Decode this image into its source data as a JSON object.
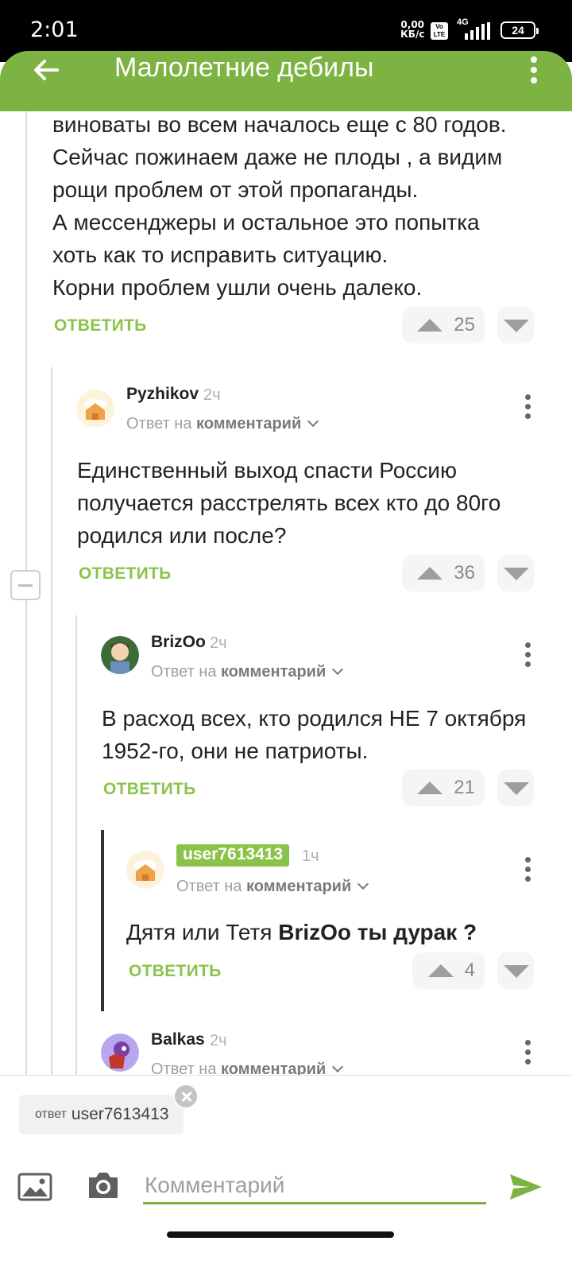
{
  "status_bar": {
    "time": "2:01",
    "speed_value": "0,00",
    "speed_unit": "КБ/с",
    "volte": "Vo LTE",
    "network": "4G",
    "battery": "24"
  },
  "toolbar": {
    "title": "Малолетние дебилы"
  },
  "comments": [
    {
      "lines": [
        "виноваты во всем началось еще с 80 годов.",
        "Сейчас пожинаем даже не плоды , а видим",
        "рощи проблем от этой пропаганды.",
        "А мессенджеры и остальное это попытка",
        "хоть как то исправить ситуацию.",
        "Корни проблем ушли очень далеко."
      ],
      "reply_label": "ОТВЕТИТЬ",
      "votes": "25"
    },
    {
      "author": "Pyzhikov",
      "time": "2ч",
      "reply_prefix": "Ответ на",
      "reply_target": "комментарий",
      "lines": [
        "Единственный выход спасти Россию",
        "получается расстрелять всех кто до 80го",
        "родился или после?"
      ],
      "reply_label": "ОТВЕТИТЬ",
      "votes": "36"
    },
    {
      "author": "BrizOo",
      "time": "2ч",
      "reply_prefix": "Ответ на",
      "reply_target": "комментарий",
      "lines": [
        "В расход всех, кто родился НЕ 7 октября",
        "1952-го, они не патриоты."
      ],
      "reply_label": "ОТВЕТИТЬ",
      "votes": "21"
    },
    {
      "author": "user7613413",
      "time": "1ч",
      "reply_prefix": "Ответ на",
      "reply_target": "комментарий",
      "text_plain": "Дятя или Тетя ",
      "text_bold": "BrizOo ты дурак ?",
      "reply_label": "ОТВЕТИТЬ",
      "votes": "4"
    },
    {
      "author": "Balkas",
      "time": "2ч",
      "reply_prefix": "Ответ на",
      "reply_target": "комментарий"
    }
  ],
  "compose": {
    "reply_chip_label": "ответ",
    "reply_chip_user": "user7613413",
    "placeholder": "Комментарий"
  },
  "colors": {
    "accent": "#7cb342",
    "link": "#8bc34a"
  }
}
